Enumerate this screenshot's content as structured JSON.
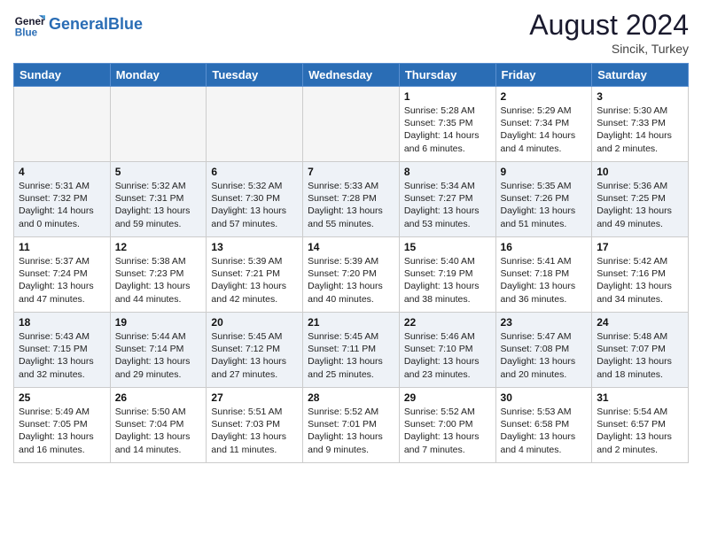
{
  "header": {
    "logo_general": "General",
    "logo_blue": "Blue",
    "month_year": "August 2024",
    "location": "Sincik, Turkey"
  },
  "days_of_week": [
    "Sunday",
    "Monday",
    "Tuesday",
    "Wednesday",
    "Thursday",
    "Friday",
    "Saturday"
  ],
  "weeks": [
    [
      {
        "day": "",
        "info": "",
        "empty": true
      },
      {
        "day": "",
        "info": "",
        "empty": true
      },
      {
        "day": "",
        "info": "",
        "empty": true
      },
      {
        "day": "",
        "info": "",
        "empty": true
      },
      {
        "day": "1",
        "info": "Sunrise: 5:28 AM\nSunset: 7:35 PM\nDaylight: 14 hours\nand 6 minutes."
      },
      {
        "day": "2",
        "info": "Sunrise: 5:29 AM\nSunset: 7:34 PM\nDaylight: 14 hours\nand 4 minutes."
      },
      {
        "day": "3",
        "info": "Sunrise: 5:30 AM\nSunset: 7:33 PM\nDaylight: 14 hours\nand 2 minutes."
      }
    ],
    [
      {
        "day": "4",
        "info": "Sunrise: 5:31 AM\nSunset: 7:32 PM\nDaylight: 14 hours\nand 0 minutes."
      },
      {
        "day": "5",
        "info": "Sunrise: 5:32 AM\nSunset: 7:31 PM\nDaylight: 13 hours\nand 59 minutes."
      },
      {
        "day": "6",
        "info": "Sunrise: 5:32 AM\nSunset: 7:30 PM\nDaylight: 13 hours\nand 57 minutes."
      },
      {
        "day": "7",
        "info": "Sunrise: 5:33 AM\nSunset: 7:28 PM\nDaylight: 13 hours\nand 55 minutes."
      },
      {
        "day": "8",
        "info": "Sunrise: 5:34 AM\nSunset: 7:27 PM\nDaylight: 13 hours\nand 53 minutes."
      },
      {
        "day": "9",
        "info": "Sunrise: 5:35 AM\nSunset: 7:26 PM\nDaylight: 13 hours\nand 51 minutes."
      },
      {
        "day": "10",
        "info": "Sunrise: 5:36 AM\nSunset: 7:25 PM\nDaylight: 13 hours\nand 49 minutes."
      }
    ],
    [
      {
        "day": "11",
        "info": "Sunrise: 5:37 AM\nSunset: 7:24 PM\nDaylight: 13 hours\nand 47 minutes."
      },
      {
        "day": "12",
        "info": "Sunrise: 5:38 AM\nSunset: 7:23 PM\nDaylight: 13 hours\nand 44 minutes."
      },
      {
        "day": "13",
        "info": "Sunrise: 5:39 AM\nSunset: 7:21 PM\nDaylight: 13 hours\nand 42 minutes."
      },
      {
        "day": "14",
        "info": "Sunrise: 5:39 AM\nSunset: 7:20 PM\nDaylight: 13 hours\nand 40 minutes."
      },
      {
        "day": "15",
        "info": "Sunrise: 5:40 AM\nSunset: 7:19 PM\nDaylight: 13 hours\nand 38 minutes."
      },
      {
        "day": "16",
        "info": "Sunrise: 5:41 AM\nSunset: 7:18 PM\nDaylight: 13 hours\nand 36 minutes."
      },
      {
        "day": "17",
        "info": "Sunrise: 5:42 AM\nSunset: 7:16 PM\nDaylight: 13 hours\nand 34 minutes."
      }
    ],
    [
      {
        "day": "18",
        "info": "Sunrise: 5:43 AM\nSunset: 7:15 PM\nDaylight: 13 hours\nand 32 minutes."
      },
      {
        "day": "19",
        "info": "Sunrise: 5:44 AM\nSunset: 7:14 PM\nDaylight: 13 hours\nand 29 minutes."
      },
      {
        "day": "20",
        "info": "Sunrise: 5:45 AM\nSunset: 7:12 PM\nDaylight: 13 hours\nand 27 minutes."
      },
      {
        "day": "21",
        "info": "Sunrise: 5:45 AM\nSunset: 7:11 PM\nDaylight: 13 hours\nand 25 minutes."
      },
      {
        "day": "22",
        "info": "Sunrise: 5:46 AM\nSunset: 7:10 PM\nDaylight: 13 hours\nand 23 minutes."
      },
      {
        "day": "23",
        "info": "Sunrise: 5:47 AM\nSunset: 7:08 PM\nDaylight: 13 hours\nand 20 minutes."
      },
      {
        "day": "24",
        "info": "Sunrise: 5:48 AM\nSunset: 7:07 PM\nDaylight: 13 hours\nand 18 minutes."
      }
    ],
    [
      {
        "day": "25",
        "info": "Sunrise: 5:49 AM\nSunset: 7:05 PM\nDaylight: 13 hours\nand 16 minutes."
      },
      {
        "day": "26",
        "info": "Sunrise: 5:50 AM\nSunset: 7:04 PM\nDaylight: 13 hours\nand 14 minutes."
      },
      {
        "day": "27",
        "info": "Sunrise: 5:51 AM\nSunset: 7:03 PM\nDaylight: 13 hours\nand 11 minutes."
      },
      {
        "day": "28",
        "info": "Sunrise: 5:52 AM\nSunset: 7:01 PM\nDaylight: 13 hours\nand 9 minutes."
      },
      {
        "day": "29",
        "info": "Sunrise: 5:52 AM\nSunset: 7:00 PM\nDaylight: 13 hours\nand 7 minutes."
      },
      {
        "day": "30",
        "info": "Sunrise: 5:53 AM\nSunset: 6:58 PM\nDaylight: 13 hours\nand 4 minutes."
      },
      {
        "day": "31",
        "info": "Sunrise: 5:54 AM\nSunset: 6:57 PM\nDaylight: 13 hours\nand 2 minutes."
      }
    ]
  ]
}
